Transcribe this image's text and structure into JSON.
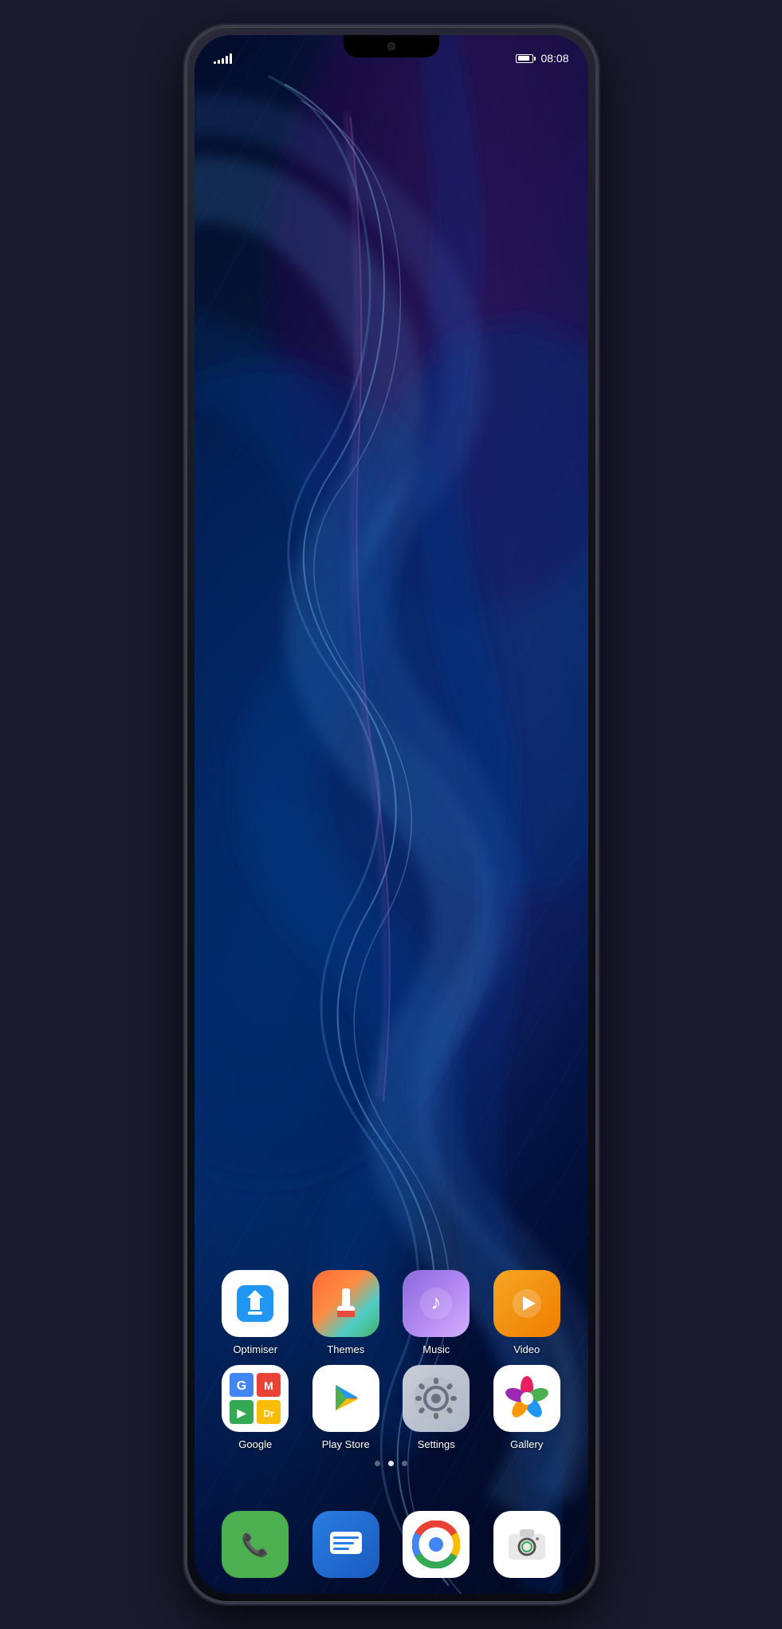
{
  "device": {
    "time": "08:08",
    "signal_bars": [
      3,
      5,
      7,
      10,
      13
    ],
    "battery_percent": 80
  },
  "status_bar": {
    "time": "08:08"
  },
  "apps_row1": [
    {
      "id": "optimiser",
      "label": "Optimiser",
      "icon_type": "optimiser"
    },
    {
      "id": "themes",
      "label": "Themes",
      "icon_type": "themes"
    },
    {
      "id": "music",
      "label": "Music",
      "icon_type": "music"
    },
    {
      "id": "video",
      "label": "Video",
      "icon_type": "video"
    }
  ],
  "apps_row2": [
    {
      "id": "google",
      "label": "Google",
      "icon_type": "google"
    },
    {
      "id": "playstore",
      "label": "Play Store",
      "icon_type": "playstore"
    },
    {
      "id": "settings",
      "label": "Settings",
      "icon_type": "settings"
    },
    {
      "id": "gallery",
      "label": "Gallery",
      "icon_type": "gallery"
    }
  ],
  "dock": [
    {
      "id": "phone",
      "icon_type": "phone"
    },
    {
      "id": "messages",
      "icon_type": "messages"
    },
    {
      "id": "chrome",
      "icon_type": "chrome"
    },
    {
      "id": "camera",
      "icon_type": "camera"
    }
  ],
  "page_dots": [
    {
      "active": false
    },
    {
      "active": true
    },
    {
      "active": false
    }
  ]
}
